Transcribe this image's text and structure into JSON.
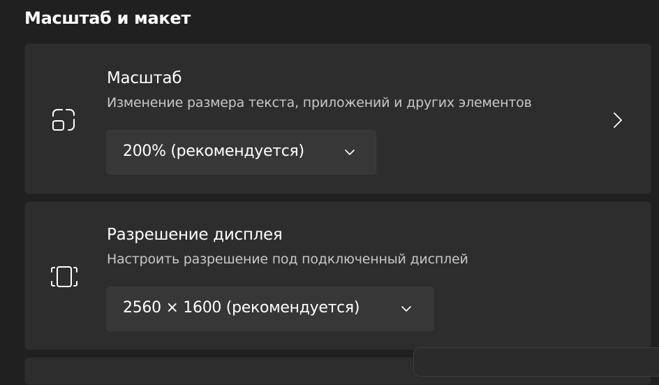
{
  "section": {
    "title": "Масштаб и макет"
  },
  "scale": {
    "title": "Масштаб",
    "description": "Изменение размера текста, приложений и других элементов",
    "dropdown_value": "200% (рекомендуется)",
    "icon": "scale-icon"
  },
  "resolution": {
    "title": "Разрешение дисплея",
    "description": "Настроить разрешение под подключенный дисплей",
    "dropdown_value": "2560 × 1600 (рекомендуется)",
    "icon": "display-resolution-icon"
  },
  "colors": {
    "background": "#202020",
    "card": "#2d2d2d",
    "dropdown": "#373737",
    "text_primary": "#ffffff",
    "text_secondary": "#c8c8c8"
  }
}
